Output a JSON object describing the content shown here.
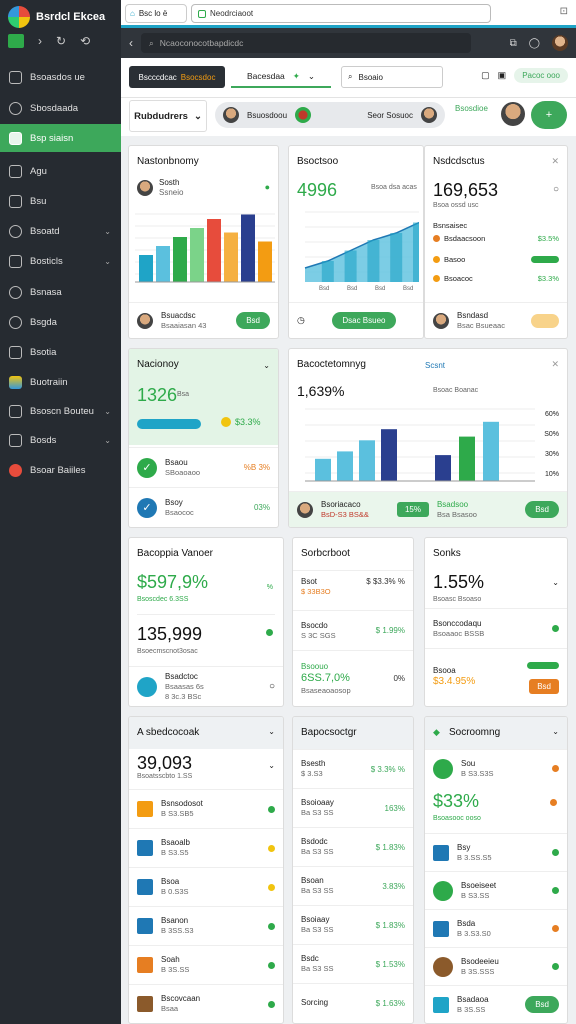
{
  "sidebar": {
    "brand": "Bsrdcl Ekcea",
    "items": [
      {
        "label": "Bsoasdos ue"
      },
      {
        "label": "Sbosdaada"
      },
      {
        "label": "Bsp siaisn"
      },
      {
        "label": "Agu"
      },
      {
        "label": "Bsu"
      },
      {
        "label": "Bsoatd"
      },
      {
        "label": "Bosticls"
      },
      {
        "label": "Bsnasa"
      },
      {
        "label": "Bsgda"
      },
      {
        "label": "Bsotia"
      },
      {
        "label": "Buotraiin"
      },
      {
        "label": "Bsoscn Bouteu"
      },
      {
        "label": "Bosds"
      },
      {
        "label": "Bsoar Baiiles"
      }
    ]
  },
  "browser": {
    "tab_label": "Bsc lo ë",
    "url": "Neodrciaoot"
  },
  "searchbar": {
    "placeholder": "Ncaoconocotbapdicdc"
  },
  "toolbar": {
    "seg_a": "Bscccdcac",
    "seg_b": "Bsocsdoc",
    "dropdown": "Bacesdaa",
    "search": "Bsoaio",
    "pill": "Pacoc ooo"
  },
  "subbar": {
    "title": "Rubdudrers",
    "mid_a": "Bsuosdoou",
    "mid_b": "Seor Sosuoc",
    "green_label": "Bsosdioe"
  },
  "cards": {
    "c1": {
      "title": "Nastonbnomy",
      "item_a": "Sosth",
      "item_b": "Ssneio",
      "name": "Bsuacdsc",
      "sub": "Bsaaiasan 43",
      "button": "Bsd",
      "bars": [
        12,
        16,
        20,
        24,
        28,
        22,
        30,
        18
      ]
    },
    "c2": {
      "title": "Bsoctsoo",
      "value": "4996",
      "cap": "Bsoa dsa acas",
      "button": "Dsac Bsueo",
      "x": [
        "Bsd",
        "Bsd",
        "Bsd",
        "Bsd"
      ]
    },
    "c3": {
      "title": "Nsdcdsctus",
      "value": "169,653",
      "cap": "Bsoa ossd usc",
      "items": [
        {
          "name": "Bsnsaisec",
          "sub": "Bsdaacsoon",
          "val": "$3.5%"
        },
        {
          "name": "Basoo",
          "sub": "",
          "val": ""
        },
        {
          "name": "Bsoacoc",
          "sub": "",
          "val": "$3.3%"
        }
      ],
      "name": "Bsndasd",
      "sub": "Bsac Bsueaac"
    },
    "c4": {
      "title": "Nacionoy",
      "value": "1326",
      "cap": "Bsa",
      "pct": "$3.3%",
      "rows": [
        {
          "name": "Bsaou",
          "sub": "SBoaoaoo",
          "val": "%B 3%"
        },
        {
          "name": "Bsoy",
          "sub": "Bsaococ",
          "val": "03%"
        }
      ]
    },
    "c5": {
      "title": "Bacoctetomnyg",
      "value": "1,639%",
      "cap": "Bsoa",
      "legend": "Scsnt",
      "side_a": "Bsoac Boanac",
      "axis": [
        "60%",
        "S0%",
        "30%",
        "10%"
      ],
      "foot_name": "Bsoriacaco",
      "foot_sub": "BsD-S3 BS&&",
      "foot_pct": "15%",
      "foot_label": "Bsadsoo",
      "foot_sub2": "Bsa Bsasoo",
      "button": "Bsd"
    },
    "c6": {
      "title": "Bacoppia Vanoer",
      "value1": "$597,9%",
      "cap1": "Bsoscdec 6.3SS",
      "value2": "135,999",
      "cap2": "Bsoecmscnot3osac",
      "row_name": "Bsadctoc",
      "row_sub": "Bsaasas 6s",
      "row_sub2": "8 3c.3 BSc"
    },
    "c7": {
      "title": "Sorbcrboot",
      "rows": [
        {
          "name": "Bsot",
          "sub": "$ 33B3O",
          "val": "$ $3.3% %"
        },
        {
          "name": "Bsocdo",
          "sub": "S 3C SGS",
          "val": "$ 1.99%"
        },
        {
          "name": "Bsoouo",
          "sub": "Bsaseaoaosop",
          "val": "6SS.7,0%",
          "extra": "0%"
        }
      ]
    },
    "c8": {
      "title": "Sonks",
      "value": "1.55%",
      "cap": "Bsoasc Bsoaso",
      "rows": [
        {
          "name": "Bsonccodaqu",
          "sub": "Bsoaaoc BSSB"
        },
        {
          "name": "Bsooa",
          "sub": "$3.4.95%",
          "button": "Bsd"
        }
      ]
    },
    "c9": {
      "title": "A sbedcocoak",
      "value": "39,093",
      "cap": "Bsoatsscbto 1.SS",
      "rows": [
        {
          "name": "Bsnsodosot",
          "sub": "B S3.SB5"
        },
        {
          "name": "Bsaoalb",
          "sub": "B S3.S5"
        },
        {
          "name": "Bsoa",
          "sub": "B 0.S3S"
        },
        {
          "name": "Bsanon",
          "sub": "B 3SS.S3"
        },
        {
          "name": "Soah",
          "sub": "B 3S.SS"
        },
        {
          "name": "Bscovcaan",
          "sub": "Bsaa"
        }
      ]
    },
    "c10": {
      "title": "Bapocsoctgr",
      "rows": [
        {
          "name": "Bsesth",
          "sub": "$ 3.S3",
          "val": "$ 3.3% %"
        },
        {
          "name": "Bsoioaay",
          "sub": "Ba S3 SS",
          "val": "163%"
        },
        {
          "name": "Bsdodc",
          "sub": "Ba S3 SS",
          "val": "$ 1.83%"
        },
        {
          "name": "Bsoan",
          "sub": "Ba S3 SS",
          "val": "3.83%"
        },
        {
          "name": "Bsoiaay",
          "sub": "Ba S3 SS",
          "val": "$ 1.83%"
        },
        {
          "name": "Bsdc",
          "sub": "Ba S3 SS",
          "val": "$ 1.53%"
        },
        {
          "name": "Sorcing",
          "sub": "",
          "val": "$ 1.63%"
        }
      ]
    },
    "c11": {
      "title": "Socroomng",
      "value": "$33%",
      "cap": "Bsoasooc ooso",
      "rows": [
        {
          "name": "Sou",
          "sub": "B S3.S3S"
        },
        {
          "name": "Bsy",
          "sub": "B 3.SS.S5"
        },
        {
          "name": "Bsoeiseet",
          "sub": "B S3.SS"
        },
        {
          "name": "Bsda",
          "sub": "B 3.S3.S0"
        },
        {
          "name": "Bsodeeieu",
          "sub": "B 3S.SSS"
        },
        {
          "name": "Bsadaoa",
          "sub": "B 3S.SS",
          "button": "Bsd"
        }
      ]
    }
  },
  "chart_data": [
    {
      "type": "bar",
      "title": "Nastonbnomy",
      "values": [
        12,
        16,
        20,
        24,
        28,
        22,
        30,
        18
      ]
    },
    {
      "type": "area",
      "title": "Bsoctsoo",
      "x": [
        "Bsd",
        "Bsd",
        "Bsd",
        "Bsd"
      ],
      "values": [
        20,
        30,
        45,
        60,
        70,
        85
      ]
    },
    {
      "type": "bar",
      "title": "Bacoctetomnyg",
      "values": [
        30,
        40,
        55,
        70,
        35,
        60,
        80
      ],
      "ylabels": [
        "60%",
        "S0%",
        "30%",
        "10%"
      ]
    }
  ]
}
